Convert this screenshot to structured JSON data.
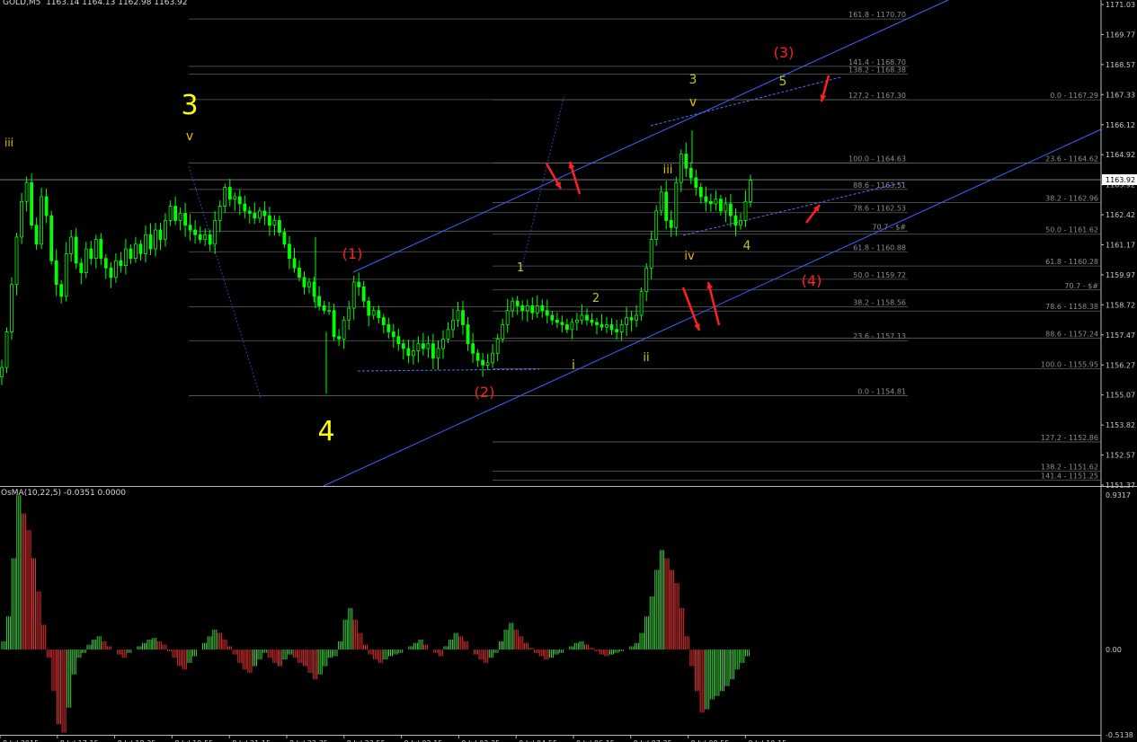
{
  "window": {
    "symbol_title": "GOLD,M5  1163.14 1164.13 1162.98 1163.92",
    "indicator_title": "OsMA(10,22,5) -0.0351 0.0000"
  },
  "colors": {
    "background": "#000000",
    "bull_candle": "#00ff00",
    "bear_candle": "#00ff00",
    "grid": "#606060",
    "fib_text": "#8e8e8e",
    "channel": "#3b63ff",
    "osma_up": "#40d040",
    "osma_down": "#e03030",
    "wave_major": "#ffff00",
    "wave_red": "#ff2020",
    "wave_green": "#b4c832",
    "wave_minor": "#e6c000"
  },
  "price_axis": {
    "min": 1151.0,
    "max": 1171.5,
    "ticks": [
      "1171.03",
      "1169.77",
      "1168.57",
      "1167.33",
      "1166.12",
      "1164.92",
      "1163.92",
      "1162.42",
      "1161.17",
      "1159.97",
      "1158.72",
      "1157.47",
      "1156.27",
      "1155.07",
      "1153.82",
      "1152.57",
      "1151.37"
    ],
    "current_price": "1163.92"
  },
  "osc_axis": {
    "ticks": [
      "0.9317",
      "0.00",
      "-0.5138"
    ],
    "max": 0.9317,
    "min": -0.5138
  },
  "time_axis": {
    "labels": [
      "8 Jul 2015",
      "8 Jul 17:15",
      "8 Jul 18:35",
      "8 Jul 19:55",
      "8 Jul 21:15",
      "8 Jul 22:35",
      "8 Jul 23:55",
      "9 Jul 02:15",
      "9 Jul 03:35",
      "9 Jul 04:55",
      "9 Jul 06:15",
      "9 Jul 07:35",
      "9 Jul 08:55",
      "9 Jul 10:15"
    ]
  },
  "fib_levels_right": [
    {
      "label": "161.8 - 1170.70",
      "price": 1170.7
    },
    {
      "label": "141.4 - 1168.70",
      "price": 1168.7
    },
    {
      "label": "138.2 - 1168.38",
      "price": 1168.38
    },
    {
      "label": "127.2 - 1167.30",
      "price": 1167.3
    },
    {
      "label": "100.0 - 1164.63",
      "price": 1164.63
    },
    {
      "label": "88.6 - 1163.51",
      "price": 1163.51
    },
    {
      "label": "78.6 - 1162.53",
      "price": 1162.53
    },
    {
      "label": "70.7 - $#",
      "price": 1161.75
    },
    {
      "label": "61.8 - 1160.88",
      "price": 1160.88
    },
    {
      "label": "50.0 - 1159.72",
      "price": 1159.72
    },
    {
      "label": "38.2 - 1158.56",
      "price": 1158.56
    },
    {
      "label": "23.6 - 1157.13",
      "price": 1157.13
    },
    {
      "label": "0.0 - 1154.81",
      "price": 1154.81
    }
  ],
  "fib_levels_far": [
    {
      "label": "0.0 - 1167.29",
      "price": 1167.29
    },
    {
      "label": "23.6 - 1164.62",
      "price": 1164.62
    },
    {
      "label": "38.2 - 1162.96",
      "price": 1162.96
    },
    {
      "label": "50.0 - 1161.62",
      "price": 1161.62
    },
    {
      "label": "61.8 - 1160.28",
      "price": 1160.28
    },
    {
      "label": "70.7 - $#",
      "price": 1159.27
    },
    {
      "label": "78.6 - 1158.38",
      "price": 1158.38
    },
    {
      "label": "88.6 - 1157.24",
      "price": 1157.24
    },
    {
      "label": "100.0 - 1155.95",
      "price": 1155.95
    },
    {
      "label": "127.2 - 1152.86",
      "price": 1152.86
    },
    {
      "label": "138.2 - 1151.62",
      "price": 1151.62
    },
    {
      "label": "141.4 - 1151.25",
      "price": 1151.25
    }
  ],
  "wave_labels": [
    {
      "text": "iii",
      "style": "minor"
    },
    {
      "text": "3",
      "style": "major"
    },
    {
      "text": "v",
      "style": "minor"
    },
    {
      "text": "4",
      "style": "major"
    },
    {
      "text": "(1)",
      "style": "red"
    },
    {
      "text": "(2)",
      "style": "red"
    },
    {
      "text": "1",
      "style": "green"
    },
    {
      "text": "2",
      "style": "green"
    },
    {
      "text": "i",
      "style": "minor"
    },
    {
      "text": "ii",
      "style": "minor"
    },
    {
      "text": "iii",
      "style": "minor"
    },
    {
      "text": "iv",
      "style": "minor"
    },
    {
      "text": "3",
      "style": "green"
    },
    {
      "text": "v",
      "style": "minor"
    },
    {
      "text": "4",
      "style": "green"
    },
    {
      "text": "5",
      "style": "green"
    },
    {
      "text": "(3)",
      "style": "red"
    },
    {
      "text": "(4)",
      "style": "red"
    }
  ],
  "price_series": [
    1156.0,
    1157.5,
    1159.5,
    1161.5,
    1163.0,
    1163.8,
    1162.0,
    1161.2,
    1163.2,
    1162.4,
    1160.5,
    1159.5,
    1159.0,
    1160.8,
    1161.5,
    1160.4,
    1160.0,
    1161.0,
    1160.6,
    1161.4,
    1160.6,
    1160.2,
    1159.8,
    1160.5,
    1160.3,
    1161.0,
    1160.6,
    1161.2,
    1160.8,
    1161.6,
    1161.0,
    1161.8,
    1161.4,
    1162.2,
    1162.8,
    1162.2,
    1162.5,
    1162.0,
    1161.8,
    1161.6,
    1161.4,
    1161.6,
    1161.2,
    1162.2,
    1162.8,
    1163.6,
    1163.1,
    1163.2,
    1162.9,
    1162.6,
    1162.5,
    1162.3,
    1162.6,
    1162.4,
    1162.0,
    1162.2,
    1161.7,
    1161.2,
    1160.6,
    1160.2,
    1159.8,
    1159.4,
    1159.6,
    1159.0,
    1158.6,
    1158.4,
    1158.4,
    1157.3,
    1157.2,
    1158.0,
    1158.5,
    1159.6,
    1159.4,
    1158.8,
    1158.2,
    1158.4,
    1158.1,
    1157.8,
    1157.5,
    1157.3,
    1157.0,
    1156.8,
    1156.5,
    1156.7,
    1157.0,
    1156.8,
    1157.0,
    1156.4,
    1156.8,
    1157.2,
    1157.6,
    1158.0,
    1158.4,
    1157.8,
    1157.0,
    1156.6,
    1156.3,
    1156.1,
    1156.2,
    1156.6,
    1157.2,
    1157.8,
    1158.4,
    1158.8,
    1158.6,
    1158.4,
    1158.6,
    1158.3,
    1158.6,
    1158.4,
    1158.2,
    1158.0,
    1157.9,
    1157.8,
    1157.6,
    1157.9,
    1158.0,
    1158.2,
    1158.0,
    1157.9,
    1157.8,
    1157.7,
    1157.8,
    1157.6,
    1157.5,
    1157.8,
    1158.1,
    1158.0,
    1158.2,
    1159.2,
    1160.2,
    1161.4,
    1162.6,
    1163.4,
    1162.2,
    1161.9,
    1163.8,
    1165.0,
    1164.4,
    1164.0,
    1163.6,
    1163.2,
    1163.0,
    1162.9,
    1163.1,
    1162.6,
    1162.9,
    1162.4,
    1162.0,
    1162.2,
    1163.0,
    1163.9
  ],
  "osma_series": [
    0.05,
    0.2,
    0.55,
    0.93,
    0.82,
    0.72,
    0.55,
    0.35,
    0.15,
    -0.05,
    -0.25,
    -0.45,
    -0.5,
    -0.35,
    -0.15,
    -0.05,
    -0.02,
    0.03,
    0.06,
    0.08,
    0.05,
    0.02,
    0.0,
    -0.03,
    -0.05,
    -0.02,
    0.0,
    0.02,
    0.04,
    0.06,
    0.07,
    0.05,
    0.03,
    -0.01,
    -0.05,
    -0.1,
    -0.12,
    -0.08,
    -0.04,
    0.0,
    0.04,
    0.08,
    0.12,
    0.1,
    0.06,
    0.02,
    -0.03,
    -0.08,
    -0.12,
    -0.14,
    -0.1,
    -0.06,
    -0.02,
    -0.05,
    -0.08,
    -0.1,
    -0.06,
    -0.03,
    -0.05,
    -0.08,
    -0.1,
    -0.14,
    -0.18,
    -0.15,
    -0.1,
    -0.05,
    -0.04,
    0.05,
    0.18,
    0.25,
    0.18,
    0.1,
    0.03,
    -0.03,
    -0.06,
    -0.08,
    -0.06,
    -0.04,
    -0.03,
    -0.02,
    0.0,
    0.02,
    0.04,
    0.06,
    0.03,
    0.0,
    -0.02,
    -0.04,
    0.02,
    0.06,
    0.1,
    0.08,
    0.05,
    0.0,
    -0.03,
    -0.06,
    -0.08,
    -0.05,
    -0.02,
    0.05,
    0.12,
    0.16,
    0.12,
    0.08,
    0.04,
    0.01,
    -0.02,
    -0.04,
    -0.06,
    -0.05,
    -0.03,
    -0.02,
    0.0,
    0.02,
    0.04,
    0.05,
    0.03,
    0.01,
    -0.01,
    -0.03,
    -0.04,
    -0.03,
    -0.02,
    -0.01,
    0.0,
    0.02,
    0.04,
    0.1,
    0.2,
    0.32,
    0.48,
    0.6,
    0.55,
    0.48,
    0.4,
    0.25,
    0.08,
    -0.1,
    -0.25,
    -0.38,
    -0.36,
    -0.3,
    -0.28,
    -0.25,
    -0.22,
    -0.18,
    -0.12,
    -0.08,
    -0.04,
    0.0
  ]
}
